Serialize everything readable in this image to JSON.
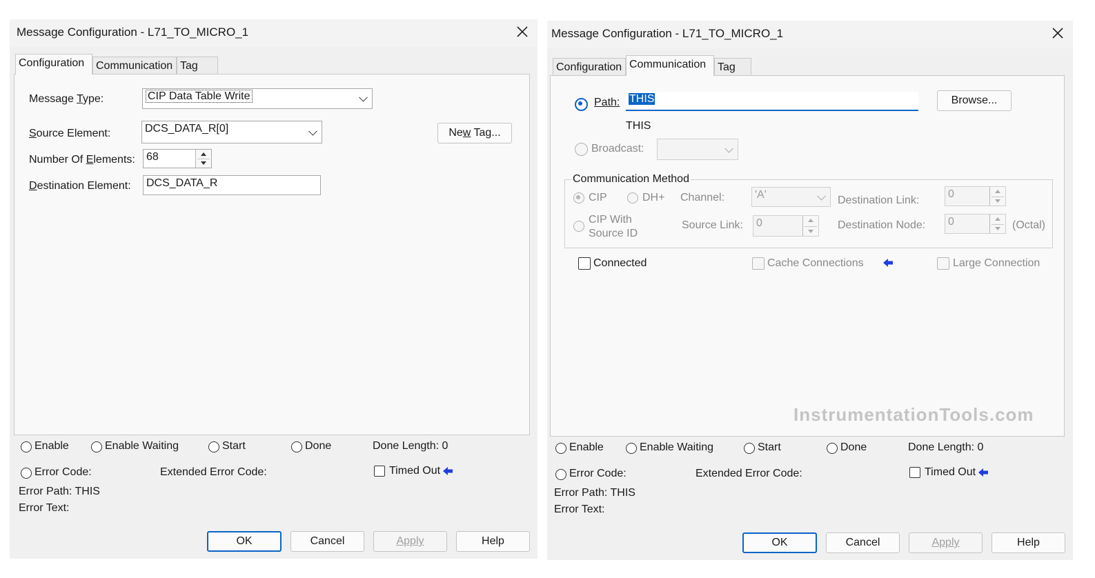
{
  "left": {
    "title": "Message Configuration - L71_TO_MICRO_1",
    "tabs": [
      "Configuration",
      "Communication",
      "Tag"
    ],
    "config": {
      "message_type_label_a": "Message ",
      "message_type_label_u": "T",
      "message_type_label_b": "ype:",
      "message_type_value": "CIP Data Table Write",
      "source_label_a": "",
      "source_label_u": "S",
      "source_label_b": "ource Element:",
      "source_value": "DCS_DATA_R[0]",
      "num_label_a": "Number Of ",
      "num_label_u": "E",
      "num_label_b": "lements:",
      "num_value": "68",
      "dest_label_a": "",
      "dest_label_u": "D",
      "dest_label_b": "estination Element:",
      "dest_value": "DCS_DATA_R",
      "new_tag_a": "Ne",
      "new_tag_u": "w",
      "new_tag_b": " Tag..."
    },
    "status": {
      "enable": "Enable",
      "enable_waiting": "Enable Waiting",
      "start": "Start",
      "done": "Done",
      "done_length": "Done Length:  0",
      "error_code": "Error Code:",
      "extended_error_code": "Extended Error Code:",
      "timed_out": "Timed Out",
      "error_path": "Error Path:  THIS",
      "error_text": "Error Text:"
    },
    "buttons": {
      "ok": "OK",
      "cancel": "Cancel",
      "apply": "Apply",
      "help": "Help"
    }
  },
  "right": {
    "title": "Message Configuration - L71_TO_MICRO_1",
    "tabs": [
      "Configuration",
      "Communication",
      "Tag"
    ],
    "comm": {
      "path_label": "Path:",
      "path_value": "THIS",
      "path_resolved": "THIS",
      "browse": "Browse...",
      "broadcast_label": "Broadcast:",
      "method_label": "Communication Method",
      "cip": "CIP",
      "dhplus": "DH+",
      "channel_label": "Channel:",
      "channel_value": "'A'",
      "dest_link_label": "Destination Link:",
      "dest_link_value": "0",
      "cip_with_source_line1": "CIP With",
      "cip_with_source_line2": "Source ID",
      "source_link_label": "Source Link:",
      "source_link_value": "0",
      "dest_node_label": "Destination Node:",
      "dest_node_value": "0",
      "octal": "(Octal)",
      "connected": "Connected",
      "cache_connections": "Cache Connections",
      "large_connection": "Large Connection"
    },
    "watermark": "InstrumentationTools.com",
    "status": {
      "enable": "Enable",
      "enable_waiting": "Enable Waiting",
      "start": "Start",
      "done": "Done",
      "done_length": "Done Length:  0",
      "error_code": "Error Code:",
      "extended_error_code": "Extended Error Code:",
      "timed_out": "Timed Out",
      "error_path": "Error Path:  THIS",
      "error_text": "Error Text:"
    },
    "buttons": {
      "ok": "OK",
      "cancel": "Cancel",
      "apply": "Apply",
      "help": "Help"
    }
  },
  "colors": {
    "accent": "#0a64c8",
    "dialog_bg": "#f0f0f0",
    "panel_bg": "#f9f9f9",
    "arrow": "#1f3fe0"
  }
}
